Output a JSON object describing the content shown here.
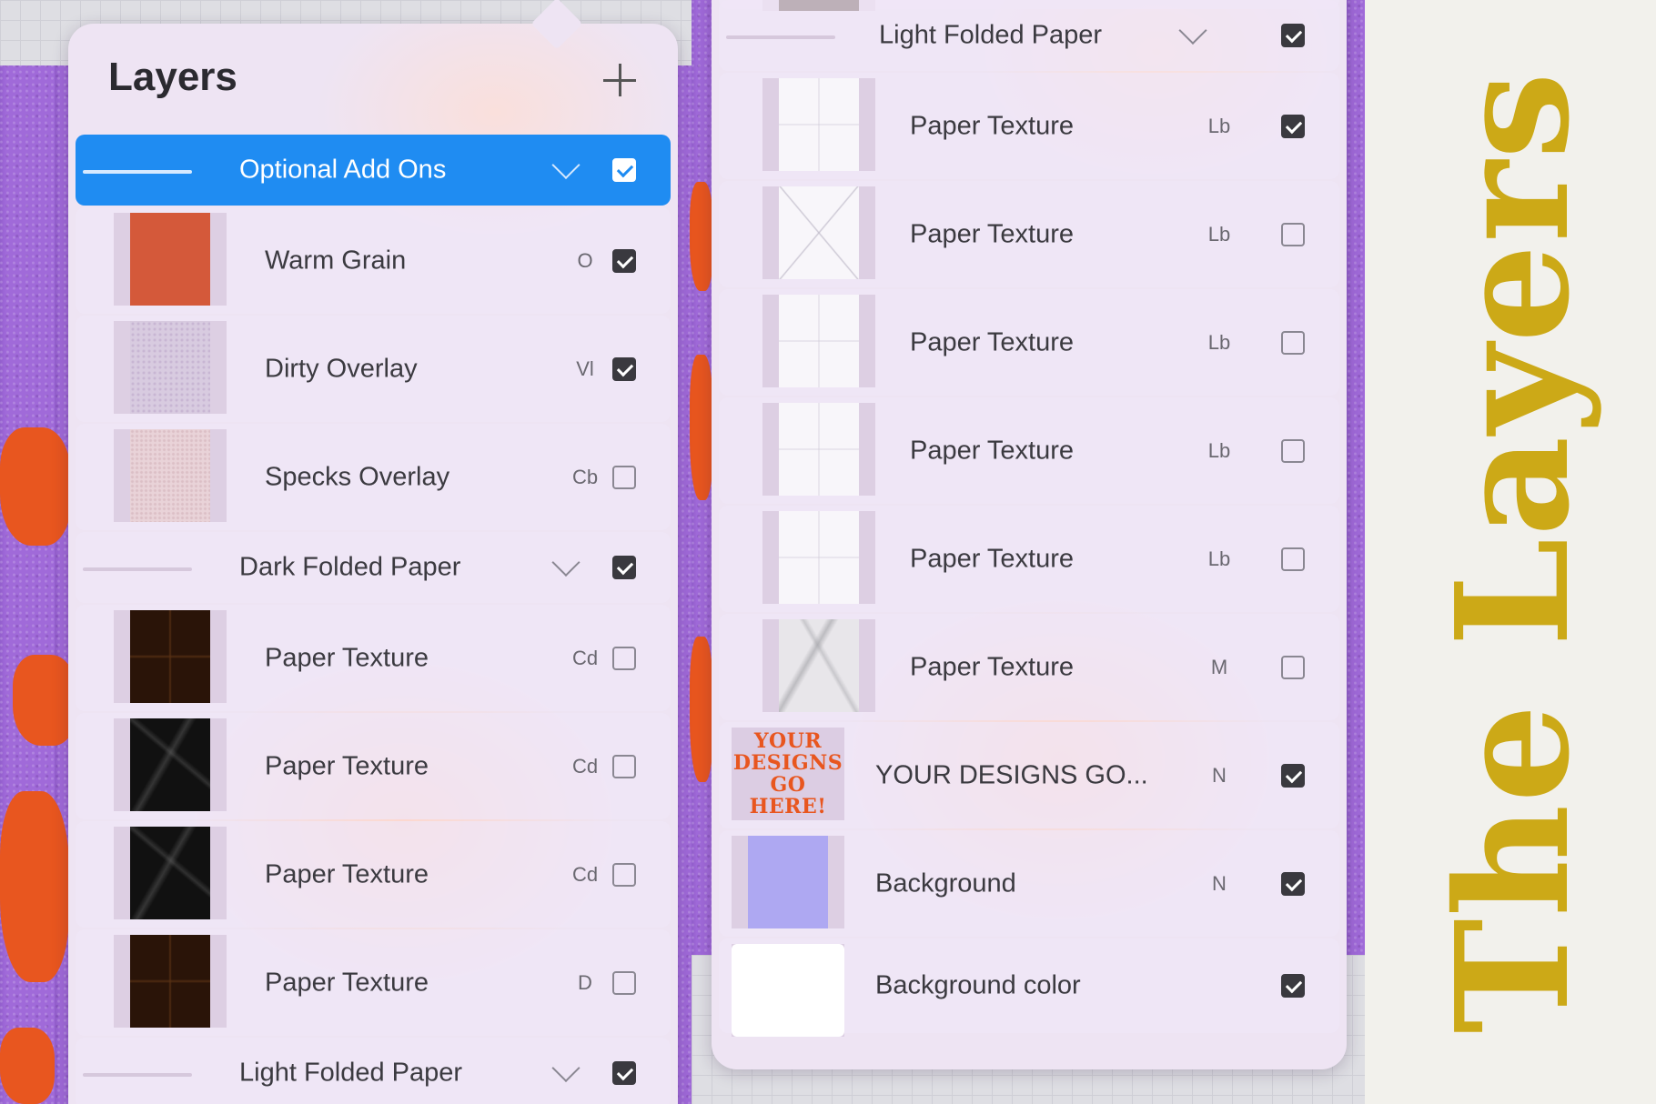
{
  "side_title": "The Layers",
  "left_panel": {
    "title": "Layers",
    "layers": [
      {
        "type": "group",
        "name": "Optional Add Ons",
        "selected": true,
        "visible": true
      },
      {
        "type": "layer",
        "name": "Warm Grain",
        "blend": "O",
        "visible": true,
        "thumb": "t-orange"
      },
      {
        "type": "layer",
        "name": "Dirty Overlay",
        "blend": "Vl",
        "visible": true,
        "thumb": "t-lilac"
      },
      {
        "type": "layer",
        "name": "Specks Overlay",
        "blend": "Cb",
        "visible": false,
        "thumb": "t-pinkish"
      },
      {
        "type": "group",
        "name": "Dark Folded Paper",
        "selected": false,
        "visible": true
      },
      {
        "type": "layer",
        "name": "Paper Texture",
        "blend": "Cd",
        "visible": false,
        "thumb": "t-darkbrown"
      },
      {
        "type": "layer",
        "name": "Paper Texture",
        "blend": "Cd",
        "visible": false,
        "thumb": "t-black"
      },
      {
        "type": "layer",
        "name": "Paper Texture",
        "blend": "Cd",
        "visible": false,
        "thumb": "t-black"
      },
      {
        "type": "layer",
        "name": "Paper Texture",
        "blend": "D",
        "visible": false,
        "thumb": "t-darkbrown"
      },
      {
        "type": "group",
        "name": "Light Folded Paper",
        "selected": false,
        "visible": true
      }
    ]
  },
  "right_panel": {
    "layers": [
      {
        "type": "group",
        "name": "Light Folded Paper",
        "visible": true
      },
      {
        "type": "layer",
        "name": "Paper Texture",
        "blend": "Lb",
        "visible": true,
        "thumb": "t-white"
      },
      {
        "type": "layer",
        "name": "Paper Texture",
        "blend": "Lb",
        "visible": false,
        "thumb": "t-whitex"
      },
      {
        "type": "layer",
        "name": "Paper Texture",
        "blend": "Lb",
        "visible": false,
        "thumb": "t-white"
      },
      {
        "type": "layer",
        "name": "Paper Texture",
        "blend": "Lb",
        "visible": false,
        "thumb": "t-white"
      },
      {
        "type": "layer",
        "name": "Paper Texture",
        "blend": "Lb",
        "visible": false,
        "thumb": "t-white"
      },
      {
        "type": "layer",
        "name": "Paper Texture",
        "blend": "M",
        "visible": false,
        "thumb": "t-crinkle"
      },
      {
        "type": "design",
        "name": "YOUR DESIGNS GO...",
        "blend": "N",
        "visible": true,
        "thumb_text": [
          "YOUR",
          "DESIGNS",
          "GO",
          "HERE!"
        ]
      },
      {
        "type": "wide",
        "name": "Background",
        "blend": "N",
        "visible": true,
        "thumb": "t-periwinkle"
      },
      {
        "type": "bgcolor",
        "name": "Background color",
        "blend": "",
        "visible": true,
        "thumb": "t-plainwhite"
      }
    ]
  },
  "colors": {
    "selected": "#1f8cf2",
    "accent_title": "#cca917",
    "purple_bg": "#a06ad9",
    "orange": "#e8561f"
  }
}
